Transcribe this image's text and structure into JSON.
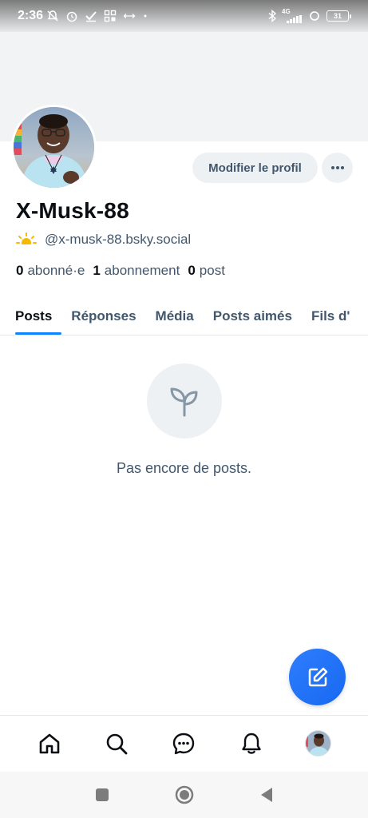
{
  "status_bar": {
    "time": "2:36",
    "left_icons": [
      "notifications-muted-icon",
      "alarm-icon",
      "check-icon",
      "grid-icon",
      "arrows-icon",
      "dot-icon"
    ],
    "network_label": "4G",
    "battery_level": "31",
    "right_icons": [
      "bluetooth-icon",
      "signal-icon",
      "sync-icon",
      "battery-icon"
    ]
  },
  "profile": {
    "display_name": "X-Musk-88",
    "handle_emoji": "🌤",
    "handle": "@x-musk-88.bsky.social",
    "edit_label": "Modifier le profil",
    "more_icon": "more-horizontal-icon",
    "stats": [
      {
        "count": "0",
        "label": "abonné·e"
      },
      {
        "count": "1",
        "label": "abonnement"
      },
      {
        "count": "0",
        "label": "post"
      }
    ]
  },
  "tabs": [
    {
      "label": "Posts",
      "active": true
    },
    {
      "label": "Réponses",
      "active": false
    },
    {
      "label": "Média",
      "active": false
    },
    {
      "label": "Posts aimés",
      "active": false
    },
    {
      "label": "Fils d'",
      "active": false
    }
  ],
  "empty_state": {
    "icon": "sprout-icon",
    "message": "Pas encore de posts."
  },
  "fab": {
    "icon": "compose-icon"
  },
  "bottom_nav": [
    "home-icon",
    "search-icon",
    "chat-icon",
    "bell-icon",
    "profile-avatar"
  ],
  "system_nav": [
    "recents-button",
    "home-button",
    "back-button"
  ],
  "colors": {
    "accent": "#1083fe",
    "text_primary": "#0b0f14",
    "text_secondary": "#42576c",
    "surface": "#eef1f4"
  }
}
